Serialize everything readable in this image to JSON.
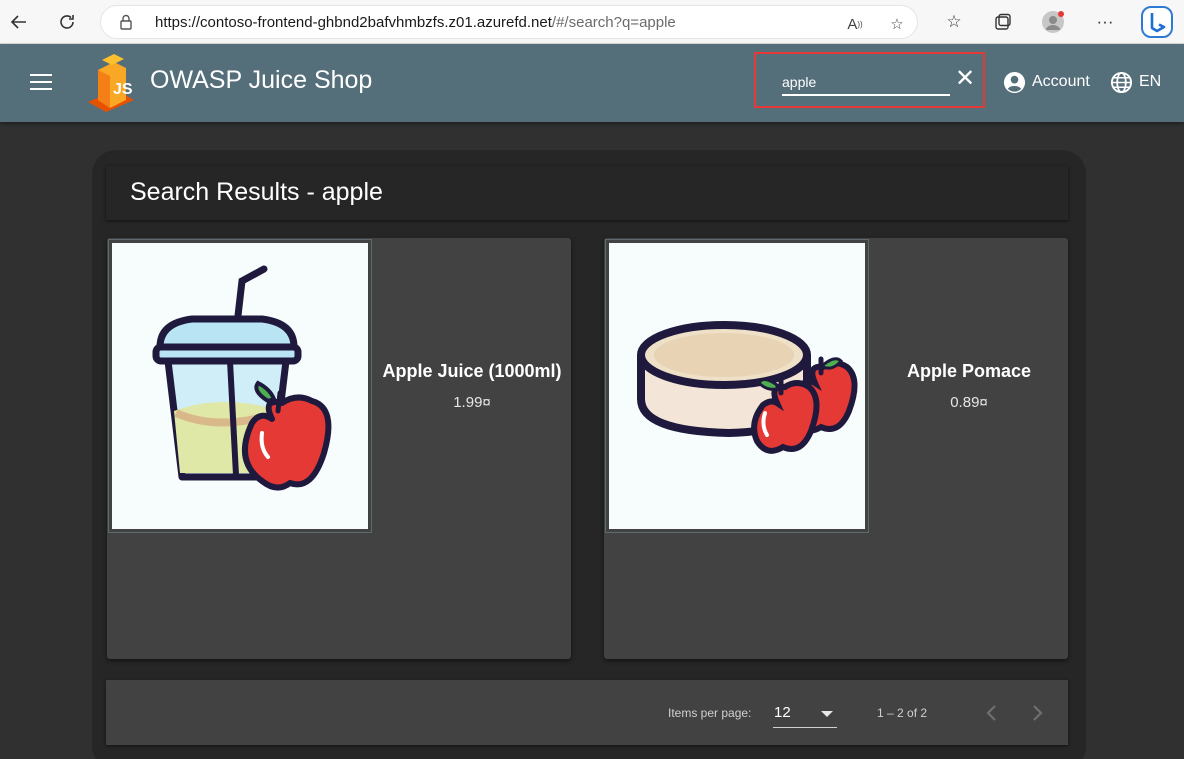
{
  "browser": {
    "url_host": "https://contoso-frontend-ghbnd2bafvhmbzfs.z01.azurefd.net",
    "url_path": "/#/search?q=apple"
  },
  "toolbar": {
    "title": "OWASP Juice Shop",
    "search_value": "apple",
    "account_label": "Account",
    "language_label": "EN",
    "colors": {
      "toolbar": "#546e7a",
      "highlight": "#e53935"
    }
  },
  "results": {
    "title": "Search Results - apple"
  },
  "products": [
    {
      "name": "Apple Juice (1000ml)",
      "price": "1.99¤",
      "icon": "apple-juice-image"
    },
    {
      "name": "Apple Pomace",
      "price": "0.89¤",
      "icon": "apple-pomace-image"
    }
  ],
  "paginator": {
    "items_per_page_label": "Items per page:",
    "page_size": "12",
    "range_label": "1 – 2 of 2"
  }
}
